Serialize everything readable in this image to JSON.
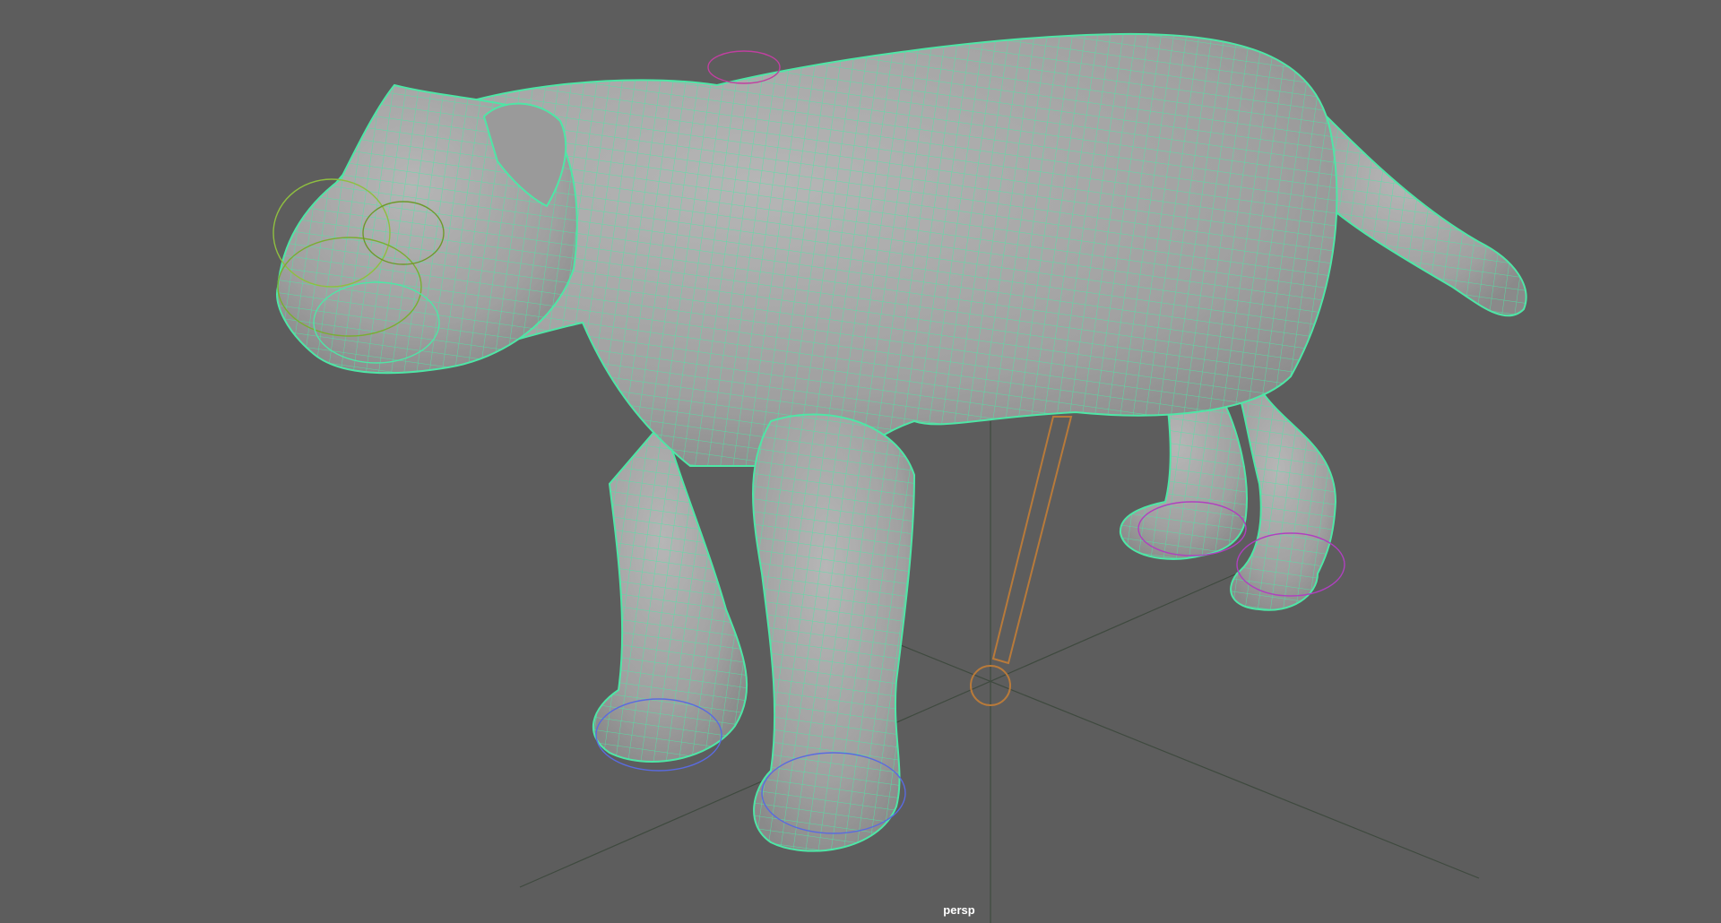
{
  "viewport": {
    "camera_label": "persp",
    "background_color": "#5d5d5d",
    "wireframe_color": "#4ee6a6",
    "mesh_color": "#a8a8a8",
    "grid_color": "#3f4a3f",
    "joint_color": "#b87a3a"
  }
}
